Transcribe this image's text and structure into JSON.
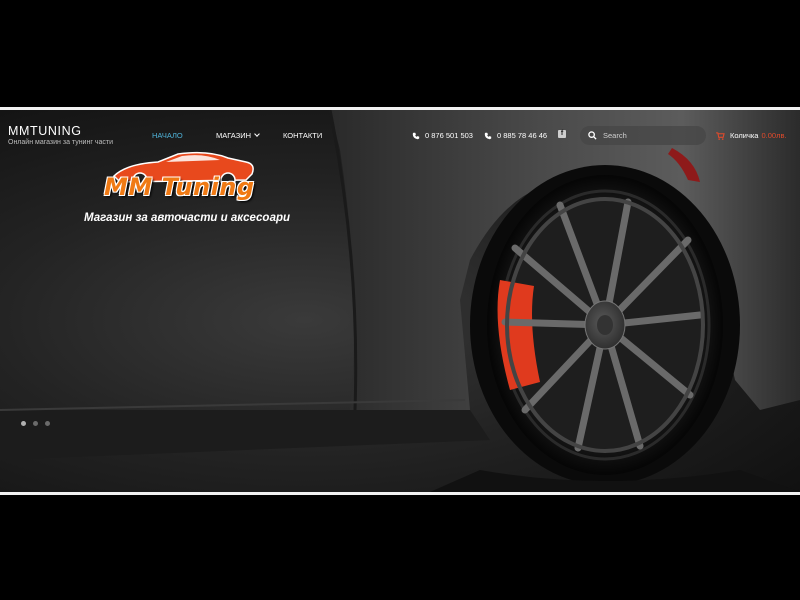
{
  "brand": {
    "name": "MMTUNING",
    "tagline": "Онлайн магазин за тунинг части"
  },
  "nav": {
    "items": [
      {
        "label": "НАЧАЛО",
        "active": true
      },
      {
        "label": "МАГАЗИН",
        "has_dropdown": true
      },
      {
        "label": "КОНТАКТИ"
      }
    ]
  },
  "contacts": {
    "phone1": "0 876 501 503",
    "phone2": "0 885 78 46 46",
    "facebook_icon": "facebook-icon",
    "phone_icon": "phone-icon"
  },
  "search": {
    "placeholder": "Search",
    "value": ""
  },
  "cart": {
    "label": "Количка",
    "amount": "0.00лв."
  },
  "hero": {
    "logo_text": "MM Tuning",
    "tagline": "Магазин за авточасти и аксесоари",
    "slides": 3,
    "active_slide": 1
  },
  "colors": {
    "accent": "#4fb3d9",
    "logo_orange": "#f07a14",
    "cart_amount": "#e24a2b",
    "brake_red": "#e03a1e"
  }
}
